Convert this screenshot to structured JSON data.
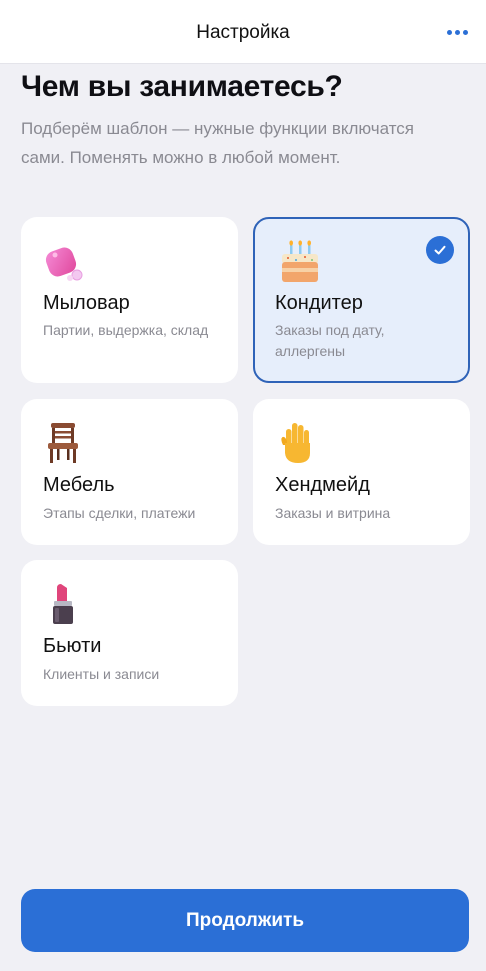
{
  "header": {
    "title": "Настройка",
    "more_icon": "more-horizontal-icon"
  },
  "heading": "Чем вы занимаетесь?",
  "subtitle": "Подберём шаблон — нужные функции включатся сами. Поменять можно в любой момент.",
  "accent_color": "#2b6fd6",
  "options": [
    {
      "title": "Мыловар",
      "desc": "Партии, выдержка, склад",
      "icon": "soap-icon",
      "selected": false
    },
    {
      "title": "Кондитер",
      "desc": "Заказы под дату, аллергены",
      "icon": "birthday-cake-icon",
      "selected": true
    },
    {
      "title": "Мебель",
      "desc": "Этапы сделки, платежи",
      "icon": "chair-icon",
      "selected": false
    },
    {
      "title": "Хендмейд",
      "desc": "Заказы и витрина",
      "icon": "raised-hand-icon",
      "selected": false
    },
    {
      "title": "Бьюти",
      "desc": "Клиенты и записи",
      "icon": "lipstick-icon",
      "selected": false
    }
  ],
  "continue_label": "Продолжить"
}
